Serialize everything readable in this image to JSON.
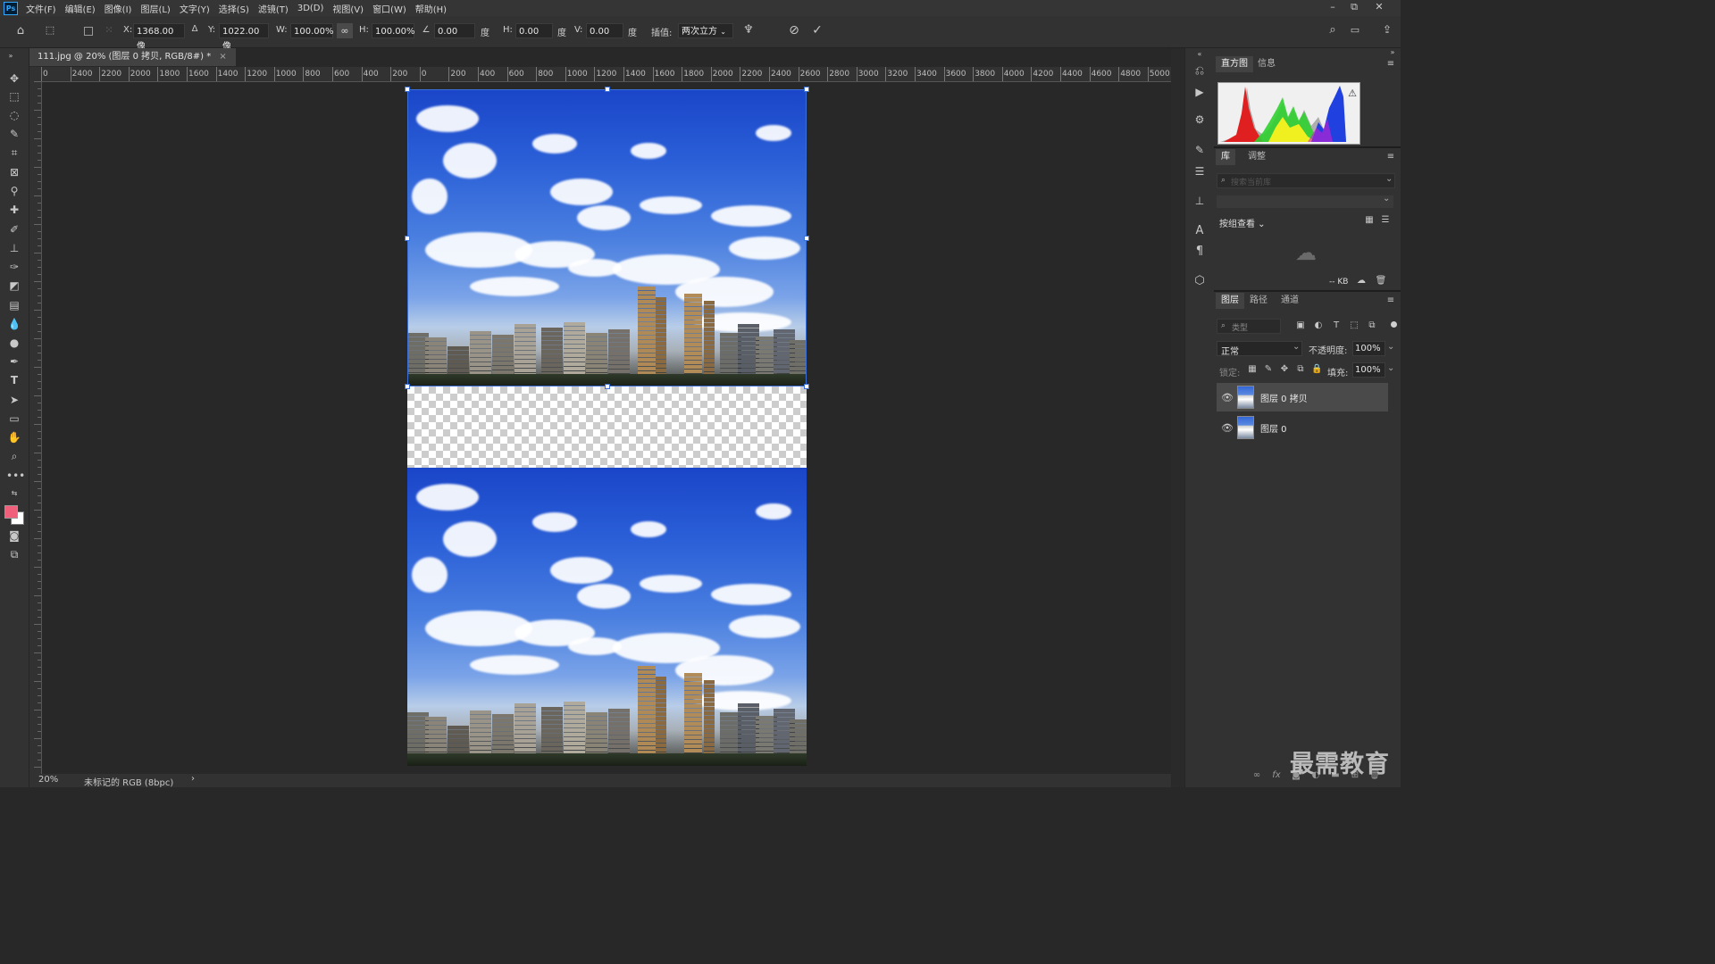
{
  "app": {
    "logo": "Ps",
    "menu": [
      "文件(F)",
      "编辑(E)",
      "图像(I)",
      "图层(L)",
      "文字(Y)",
      "选择(S)",
      "滤镜(T)",
      "3D(D)",
      "视图(V)",
      "窗口(W)",
      "帮助(H)"
    ],
    "window_controls": [
      "–",
      "⧉",
      "✕"
    ]
  },
  "options": {
    "x_label": "X:",
    "x_value": "1368.00 像",
    "y_label": "Y:",
    "y_value": "1022.00 像",
    "w_label": "W:",
    "w_value": "100.00%",
    "h_label": "H:",
    "h_value": "100.00%",
    "angle_value": "0.00",
    "angle_unit": "度",
    "hskew_label": "H:",
    "hskew_value": "0.00",
    "hskew_unit": "度",
    "vskew_label": "V:",
    "vskew_value": "0.00",
    "vskew_unit": "度",
    "interp_label": "插值:",
    "interp_value": "两次立方"
  },
  "document": {
    "tab_title": "111.jpg @ 20% (图层 0 拷贝, RGB/8#) *",
    "tab_close": "×"
  },
  "ruler": {
    "h_ticks": [
      "0",
      "2400",
      "2200",
      "2000",
      "1800",
      "1600",
      "1400",
      "1200",
      "1000",
      "800",
      "600",
      "400",
      "200",
      "0",
      "200",
      "400",
      "600",
      "800",
      "1000",
      "1200",
      "1400",
      "1600",
      "1800",
      "2000",
      "2200",
      "2400",
      "2600",
      "2800",
      "3000",
      "3200",
      "3400",
      "3600",
      "3800",
      "4000",
      "4200",
      "4400",
      "4600",
      "4800",
      "5000"
    ]
  },
  "status": {
    "zoom": "20%",
    "profile": "未标记的 RGB (8bpc)",
    "arrow": "›"
  },
  "panels": {
    "histogram_tabs": [
      "直方图",
      "信息"
    ],
    "library_tabs": [
      "库",
      "调整"
    ],
    "library_search_placeholder": "搜索当前库",
    "library_view": "按组查看",
    "library_size": "-- KB",
    "layers_tabs": [
      "图层",
      "路径",
      "通道"
    ],
    "layer_filter": "类型",
    "blend_mode": "正常",
    "opacity_label": "不透明度:",
    "opacity_value": "100%",
    "lock_label": "锁定:",
    "fill_label": "填充:",
    "fill_value": "100%",
    "layers": [
      {
        "name": "图层 0 拷贝",
        "selected": true
      },
      {
        "name": "图层 0",
        "selected": false
      }
    ]
  },
  "watermark": "最需教育",
  "colors": {
    "foreground": "#f0607a",
    "background": "#ffffff",
    "selection_handle": "#3a6fd8"
  }
}
